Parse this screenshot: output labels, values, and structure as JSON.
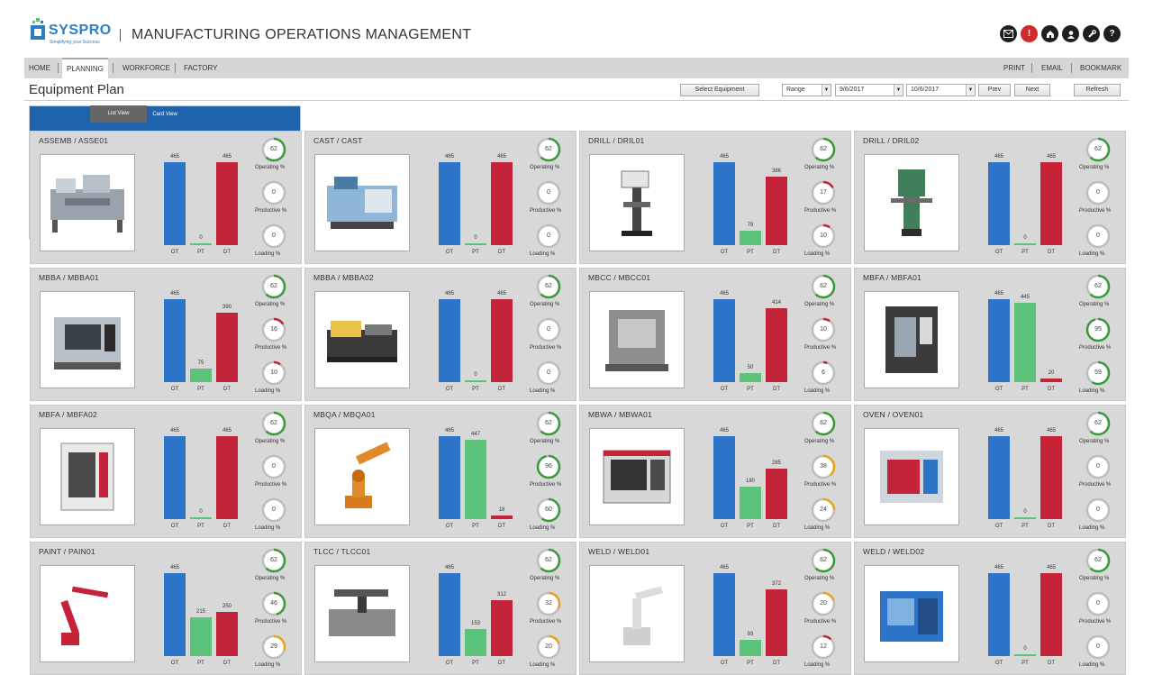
{
  "header": {
    "brand": "SYSPRO",
    "tagline": "Simplifying your Success",
    "app_title": "MANUFACTURING OPERATIONS MANAGEMENT",
    "icons": [
      "envelope-icon",
      "alert-icon",
      "home-icon",
      "user-icon",
      "wrench-icon",
      "help-icon"
    ]
  },
  "nav": {
    "left": [
      "HOME",
      "PLANNING",
      "WORKFORCE",
      "FACTORY"
    ],
    "active": "PLANNING",
    "right": [
      "PRINT",
      "EMAIL",
      "BOOKMARK"
    ]
  },
  "toolbar": {
    "page_title": "Equipment Plan",
    "select_equipment": "Select Equipment",
    "range": "Range",
    "from_date": "9/6/2017",
    "to_date": "10/6/2017",
    "prev": "Prev",
    "next": "Next",
    "refresh": "Refresh",
    "card_view": "Card View",
    "list_view": "List View"
  },
  "labels": {
    "ot": "OT",
    "pt": "PT",
    "dt": "DT",
    "operating": "Operating %",
    "productive": "Productive %",
    "loading": "Loading %"
  },
  "colors": {
    "ot": "#2d74c9",
    "pt": "#5cc47a",
    "dt": "#c4243a",
    "gauge_green": "#3a9a3a",
    "gauge_red": "#c4243a",
    "gauge_amber": "#e8a317",
    "gauge_track": "#bdbdbd"
  },
  "cards": [
    {
      "title": "ASSEMB / ASSE01",
      "ot": 465,
      "pt": 0,
      "dt": 465,
      "operating": 62,
      "productive": 0,
      "loading": 0,
      "photo": "assembly-line"
    },
    {
      "title": "CAST / CAST",
      "ot": 465,
      "pt": 0,
      "dt": 465,
      "operating": 62,
      "productive": 0,
      "loading": 0,
      "photo": "casting-machine"
    },
    {
      "title": "DRILL / DRIL01",
      "ot": 465,
      "pt": 79,
      "dt": 386,
      "operating": 62,
      "productive": 17,
      "loading": 10,
      "photo": "drill-press"
    },
    {
      "title": "DRILL / DRIL02",
      "ot": 465,
      "pt": 0,
      "dt": 465,
      "operating": 62,
      "productive": 0,
      "loading": 0,
      "photo": "band-saw"
    },
    {
      "title": "MBBA / MBBA01",
      "ot": 465,
      "pt": 75,
      "dt": 390,
      "operating": 62,
      "productive": 16,
      "loading": 10,
      "photo": "cnc-lathe"
    },
    {
      "title": "MBBA / MBBA02",
      "ot": 465,
      "pt": 0,
      "dt": 465,
      "operating": 62,
      "productive": 0,
      "loading": 0,
      "photo": "injection-molder"
    },
    {
      "title": "MBCC / MBCC01",
      "ot": 465,
      "pt": 50,
      "dt": 414,
      "operating": 62,
      "productive": 10,
      "loading": 6,
      "photo": "machining-center"
    },
    {
      "title": "MBFA / MBFA01",
      "ot": 465,
      "pt": 445,
      "dt": 20,
      "operating": 62,
      "productive": 95,
      "loading": 59,
      "photo": "vertical-mill"
    },
    {
      "title": "MBFA / MBFA02",
      "ot": 465,
      "pt": 0,
      "dt": 465,
      "operating": 62,
      "productive": 0,
      "loading": 0,
      "photo": "cnc-cabinet"
    },
    {
      "title": "MBQA / MBQA01",
      "ot": 465,
      "pt": 447,
      "dt": 18,
      "operating": 62,
      "productive": 96,
      "loading": 60,
      "photo": "robot-arm"
    },
    {
      "title": "MBWA / MBWA01",
      "ot": 465,
      "pt": 180,
      "dt": 285,
      "operating": 62,
      "productive": 38,
      "loading": 24,
      "photo": "mazak-center"
    },
    {
      "title": "OVEN / OVEN01",
      "ot": 465,
      "pt": 0,
      "dt": 465,
      "operating": 62,
      "productive": 0,
      "loading": 0,
      "photo": "oven-machine"
    },
    {
      "title": "PAINT / PAIN01",
      "ot": 465,
      "pt": 215,
      "dt": 250,
      "operating": 62,
      "productive": 46,
      "loading": 29,
      "photo": "paint-robot"
    },
    {
      "title": "TLCC / TLCC01",
      "ot": 465,
      "pt": 153,
      "dt": 312,
      "operating": 62,
      "productive": 32,
      "loading": 20,
      "photo": "gantry-router"
    },
    {
      "title": "WELD / WELD01",
      "ot": 465,
      "pt": 93,
      "dt": 372,
      "operating": 62,
      "productive": 20,
      "loading": 12,
      "photo": "weld-robot"
    },
    {
      "title": "WELD / WELD02",
      "ot": 465,
      "pt": 0,
      "dt": 465,
      "operating": 62,
      "productive": 0,
      "loading": 0,
      "photo": "weld-station"
    }
  ]
}
